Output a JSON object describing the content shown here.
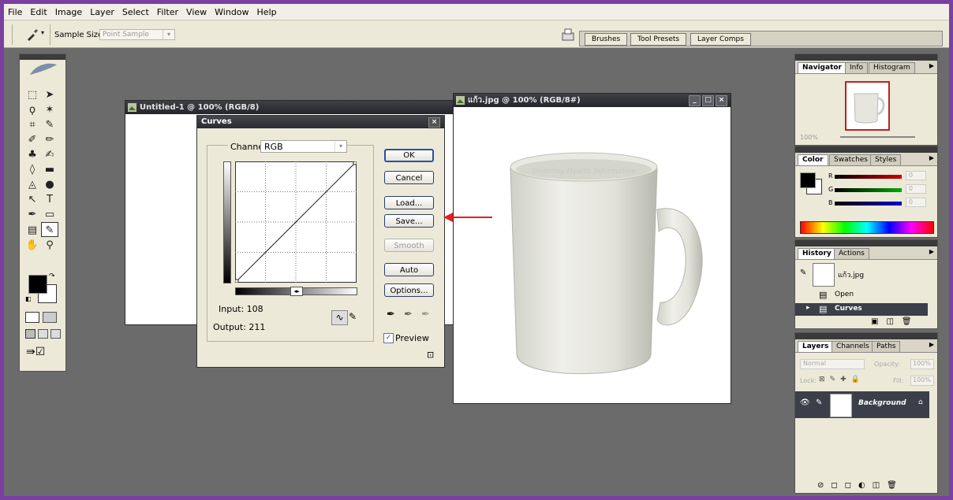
{
  "menu": [
    "File",
    "Edit",
    "Image",
    "Layer",
    "Select",
    "Filter",
    "View",
    "Window",
    "Help"
  ],
  "options": {
    "sample_label": "Sample Size:",
    "sample_value": "Point Sample"
  },
  "palette_well": {
    "tabs": [
      "Brushes",
      "Tool Presets",
      "Layer Comps"
    ]
  },
  "doc_untitled": {
    "title": "Untitled-1 @ 100% (RGB/8)"
  },
  "doc_mug": {
    "title": "แก้ว.jpg @ 100% (RGB/8#)",
    "mug_text": "Inspiring Health Information"
  },
  "curves": {
    "title": "Curves",
    "channel_label": "Channel:",
    "channel_value": "RGB",
    "buttons": {
      "ok": "OK",
      "cancel": "Cancel",
      "load": "Load...",
      "save": "Save...",
      "smooth": "Smooth",
      "auto": "Auto",
      "options": "Options..."
    },
    "input_label": "Input: 108",
    "output_label": "Output: 211",
    "preview_label": "Preview"
  },
  "navigator": {
    "tabs": [
      "Navigator",
      "Info",
      "Histogram"
    ],
    "zoom": "100%"
  },
  "color": {
    "tabs": [
      "Color",
      "Swatches",
      "Styles"
    ],
    "r_label": "R",
    "g_label": "G",
    "b_label": "B",
    "r_value": "0",
    "g_value": "0",
    "b_value": "0"
  },
  "history": {
    "tabs": [
      "History",
      "Actions"
    ],
    "snapshot": "แก้ว.jpg",
    "items": [
      "Open",
      "Curves"
    ]
  },
  "layers": {
    "tabs": [
      "Layers",
      "Channels",
      "Paths"
    ],
    "blend": "Normal",
    "opacity_label": "Opacity:",
    "opacity_value": "100%",
    "lock_label": "Lock:",
    "fill_label": "Fill:",
    "fill_value": "100%",
    "layer_name": "Background"
  },
  "colors": {
    "frame": "#7a3fa3",
    "workspace": "#6b6b6b",
    "annotation_arrow": "#e02020",
    "selected_row": "#3c3f4a"
  }
}
